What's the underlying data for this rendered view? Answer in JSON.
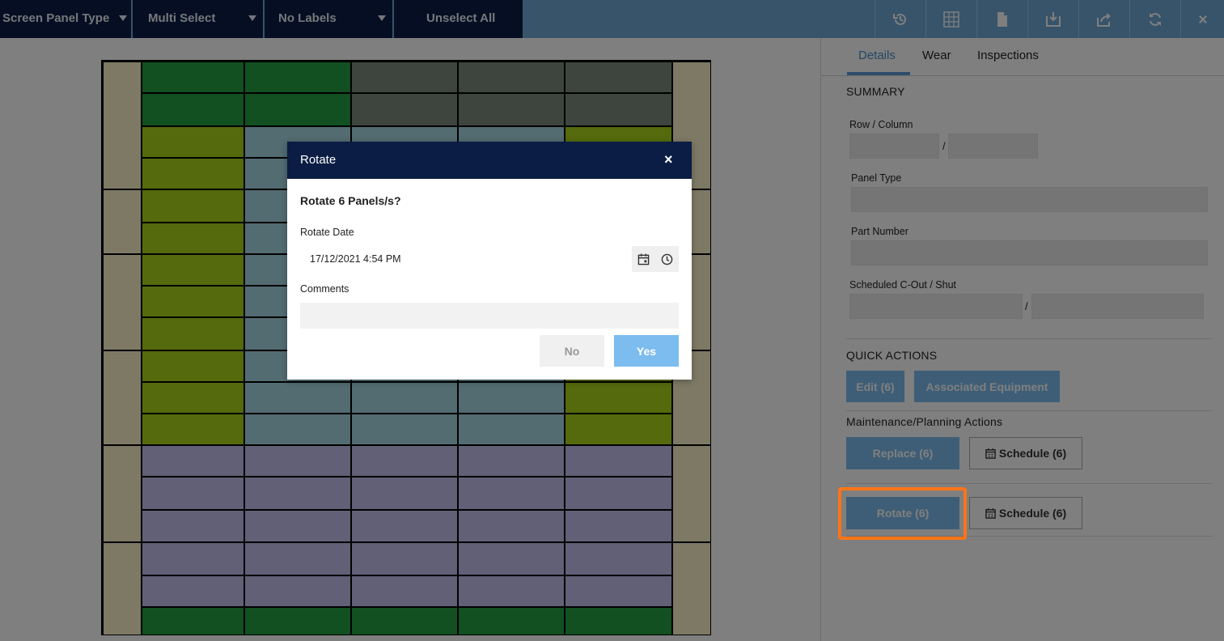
{
  "toolbar": {
    "dropdowns": [
      {
        "label": "Screen Panel Type"
      },
      {
        "label": "Multi Select"
      },
      {
        "label": "No Labels"
      }
    ],
    "unselect_all": "Unselect All",
    "tools": [
      "history-icon",
      "grid-icon",
      "document-icon",
      "download-icon",
      "share-icon",
      "refresh-icon",
      "close-icon"
    ]
  },
  "grid": {
    "colors": {
      "side": "#faf2c8",
      "green": "#259f43",
      "dark_grey": "#7a8b7c",
      "lime": "#a9d41b",
      "teal": "#a4d8e4",
      "lavender": "#c4c0ee"
    }
  },
  "details": {
    "tabs": [
      "Details",
      "Wear",
      "Inspections"
    ],
    "active_tab": "Details",
    "summary_title": "SUMMARY",
    "row_col_label": "Row / Column",
    "slash": "/",
    "panel_type_label": "Panel Type",
    "part_number_label": "Part Number",
    "scheduled_label": "Scheduled C-Out / Shut",
    "quick_actions_title": "QUICK ACTIONS",
    "edit_btn": "Edit (6)",
    "associated_btn": "Associated Equipment",
    "maint_title": "Maintenance/Planning Actions",
    "replace_btn": "Replace (6)",
    "schedule_btn": "Schedule (6)",
    "rotate_btn": "Rotate (6)",
    "schedule_btn_2": "Schedule (6)"
  },
  "modal": {
    "title": "Rotate",
    "close": "×",
    "question": "Rotate 6 Panels/s?",
    "date_label": "Rotate Date",
    "date_value": "17/12/2021 4:54 PM",
    "comments_label": "Comments",
    "no": "No",
    "yes": "Yes"
  },
  "colors": {
    "toolbar_dark": "#0b1d44",
    "toolbar_light": "#6fa8d6",
    "accent_blue": "#7cbcef",
    "highlight": "#ff7417"
  }
}
